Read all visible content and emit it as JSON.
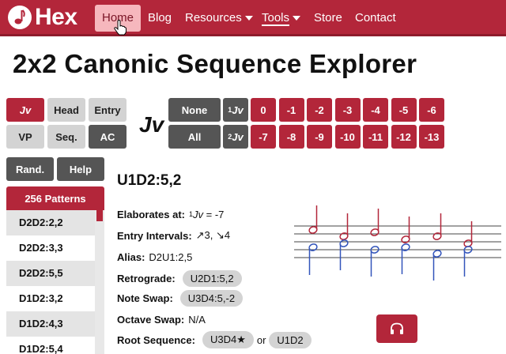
{
  "nav": {
    "logo_text": "Hex",
    "items": [
      {
        "label": "Home"
      },
      {
        "label": "Blog"
      },
      {
        "label": "Resources"
      },
      {
        "label": "Tools"
      },
      {
        "label": "Store"
      },
      {
        "label": "Contact"
      }
    ]
  },
  "page_title": "2x2 Canonic Sequence Explorer",
  "mode_buttons": {
    "jv": "Jv",
    "head": "Head",
    "entry": "Entry",
    "vp": "VP",
    "seq": "Seq.",
    "ac": "AC"
  },
  "current_mode": "Jv",
  "filter": {
    "none": "None",
    "all": "All",
    "jv1": "1Jv",
    "jv2": "2Jv",
    "row1": [
      "0",
      "-1",
      "-2",
      "-3",
      "-4",
      "-5",
      "-6"
    ],
    "row2": [
      "-7",
      "-8",
      "-9",
      "-10",
      "-11",
      "-12",
      "-13"
    ]
  },
  "list_controls": {
    "random": "Rand.",
    "help": "Help"
  },
  "patterns_header": "256 Patterns",
  "patterns": [
    "D2D2:2,2",
    "D2D2:3,3",
    "D2D2:5,5",
    "D1D2:3,2",
    "D1D2:4,3",
    "D1D2:5,4"
  ],
  "detail": {
    "title": "U1D2:5,2",
    "elaborates_label": "Elaborates at:",
    "elaborates_sup": "1",
    "elaborates_jv": "Jv",
    "elaborates_value": "= -7",
    "entry_label": "Entry Intervals:",
    "entry_value": "↗3, ↘4",
    "alias_label": "Alias:",
    "alias_value": "D2U1:2,5",
    "retrograde_label": "Retrograde:",
    "retrograde_value": "U2D1:5,2",
    "note_swap_label": "Note Swap:",
    "note_swap_value": "U3D4:5,-2",
    "octave_swap_label": "Octave Swap:",
    "octave_swap_value": "N/A",
    "root_label": "Root Sequence:",
    "root_value1": "U3D4★",
    "root_or": "or",
    "root_value2": "U1D2"
  },
  "colors": {
    "brand": "#b3263a",
    "upper_voice": "#b3263a",
    "lower_voice": "#3355bb"
  },
  "icons": {
    "audio": "headphones-icon",
    "logo": "music-note-icon"
  }
}
